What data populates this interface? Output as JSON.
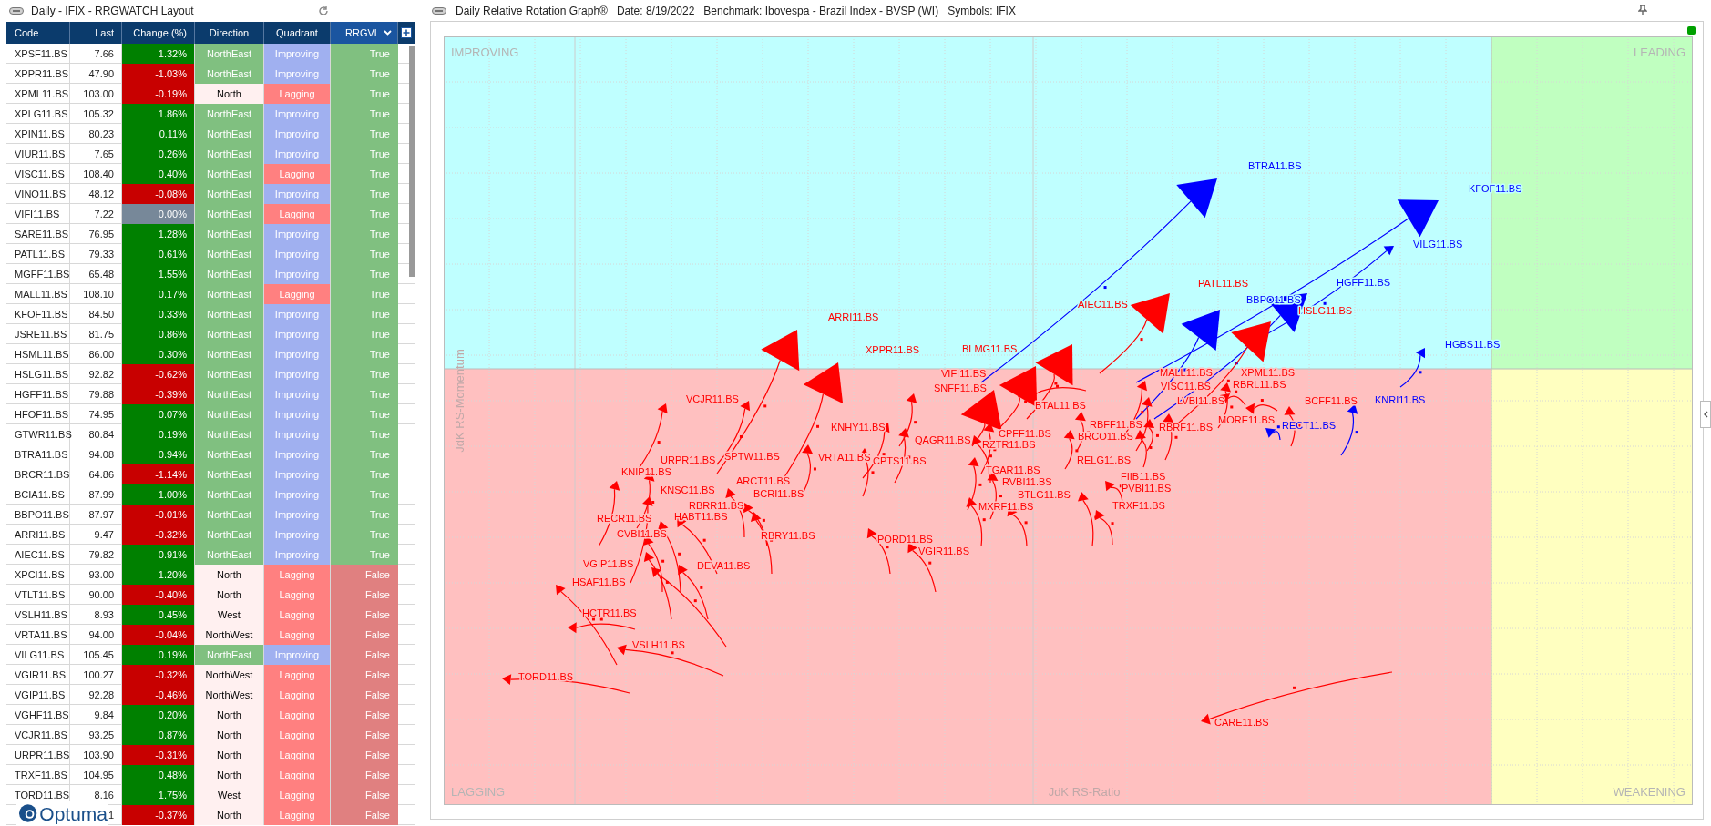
{
  "watchlist": {
    "title": "Daily - IFIX - RRGWATCH Layout",
    "columns": [
      "Code",
      "Last",
      "Change (%)",
      "Direction",
      "Quadrant",
      "RRGVL"
    ],
    "rows": [
      {
        "code": "XPSF11.BS",
        "last": "7.66",
        "change": {
          "text": "1.32%",
          "color": "#008000"
        },
        "direction": {
          "text": "NorthEast",
          "color": "#80c080"
        },
        "quadrant": {
          "text": "Improving",
          "color": "#a0b0f0"
        },
        "rrgvl": {
          "text": "True",
          "color": "#80c080"
        }
      },
      {
        "code": "XPPR11.BS",
        "last": "47.90",
        "change": {
          "text": "-1.03%",
          "color": "#c80000"
        },
        "direction": {
          "text": "NorthEast",
          "color": "#80c080"
        },
        "quadrant": {
          "text": "Improving",
          "color": "#a0b0f0"
        },
        "rrgvl": {
          "text": "True",
          "color": "#80c080"
        }
      },
      {
        "code": "XPML11.BS",
        "last": "103.00",
        "change": {
          "text": "-0.19%",
          "color": "#c80000"
        },
        "direction": {
          "text": "North",
          "color": "#fff0f0"
        },
        "quadrant": {
          "text": "Lagging",
          "color": "#ff8080"
        },
        "rrgvl": {
          "text": "True",
          "color": "#80c080"
        }
      },
      {
        "code": "XPLG11.BS",
        "last": "105.32",
        "change": {
          "text": "1.86%",
          "color": "#008000"
        },
        "direction": {
          "text": "NorthEast",
          "color": "#80c080"
        },
        "quadrant": {
          "text": "Improving",
          "color": "#a0b0f0"
        },
        "rrgvl": {
          "text": "True",
          "color": "#80c080"
        }
      },
      {
        "code": "XPIN11.BS",
        "last": "80.23",
        "change": {
          "text": "0.11%",
          "color": "#008000"
        },
        "direction": {
          "text": "NorthEast",
          "color": "#80c080"
        },
        "quadrant": {
          "text": "Improving",
          "color": "#a0b0f0"
        },
        "rrgvl": {
          "text": "True",
          "color": "#80c080"
        }
      },
      {
        "code": "VIUR11.BS",
        "last": "7.65",
        "change": {
          "text": "0.26%",
          "color": "#008000"
        },
        "direction": {
          "text": "NorthEast",
          "color": "#80c080"
        },
        "quadrant": {
          "text": "Improving",
          "color": "#a0b0f0"
        },
        "rrgvl": {
          "text": "True",
          "color": "#80c080"
        }
      },
      {
        "code": "VISC11.BS",
        "last": "108.40",
        "change": {
          "text": "0.40%",
          "color": "#008000"
        },
        "direction": {
          "text": "NorthEast",
          "color": "#80c080"
        },
        "quadrant": {
          "text": "Lagging",
          "color": "#ff8080"
        },
        "rrgvl": {
          "text": "True",
          "color": "#80c080"
        }
      },
      {
        "code": "VINO11.BS",
        "last": "48.12",
        "change": {
          "text": "-0.08%",
          "color": "#c80000"
        },
        "direction": {
          "text": "NorthEast",
          "color": "#80c080"
        },
        "quadrant": {
          "text": "Improving",
          "color": "#a0b0f0"
        },
        "rrgvl": {
          "text": "True",
          "color": "#80c080"
        }
      },
      {
        "code": "VIFI11.BS",
        "last": "7.22",
        "change": {
          "text": "0.00%",
          "color": "#778899"
        },
        "direction": {
          "text": "NorthEast",
          "color": "#80c080"
        },
        "quadrant": {
          "text": "Lagging",
          "color": "#ff8080"
        },
        "rrgvl": {
          "text": "True",
          "color": "#80c080"
        }
      },
      {
        "code": "SARE11.BS",
        "last": "76.95",
        "change": {
          "text": "1.28%",
          "color": "#008000"
        },
        "direction": {
          "text": "NorthEast",
          "color": "#80c080"
        },
        "quadrant": {
          "text": "Improving",
          "color": "#a0b0f0"
        },
        "rrgvl": {
          "text": "True",
          "color": "#80c080"
        }
      },
      {
        "code": "PATL11.BS",
        "last": "79.33",
        "change": {
          "text": "0.61%",
          "color": "#008000"
        },
        "direction": {
          "text": "NorthEast",
          "color": "#80c080"
        },
        "quadrant": {
          "text": "Improving",
          "color": "#a0b0f0"
        },
        "rrgvl": {
          "text": "True",
          "color": "#80c080"
        }
      },
      {
        "code": "MGFF11.BS",
        "last": "65.48",
        "change": {
          "text": "1.55%",
          "color": "#008000"
        },
        "direction": {
          "text": "NorthEast",
          "color": "#80c080"
        },
        "quadrant": {
          "text": "Improving",
          "color": "#a0b0f0"
        },
        "rrgvl": {
          "text": "True",
          "color": "#80c080"
        }
      },
      {
        "code": "MALL11.BS",
        "last": "108.10",
        "change": {
          "text": "0.17%",
          "color": "#008000"
        },
        "direction": {
          "text": "NorthEast",
          "color": "#80c080"
        },
        "quadrant": {
          "text": "Lagging",
          "color": "#ff8080"
        },
        "rrgvl": {
          "text": "True",
          "color": "#80c080"
        }
      },
      {
        "code": "KFOF11.BS",
        "last": "84.50",
        "change": {
          "text": "0.33%",
          "color": "#008000"
        },
        "direction": {
          "text": "NorthEast",
          "color": "#80c080"
        },
        "quadrant": {
          "text": "Improving",
          "color": "#a0b0f0"
        },
        "rrgvl": {
          "text": "True",
          "color": "#80c080"
        }
      },
      {
        "code": "JSRE11.BS",
        "last": "81.75",
        "change": {
          "text": "0.86%",
          "color": "#008000"
        },
        "direction": {
          "text": "NorthEast",
          "color": "#80c080"
        },
        "quadrant": {
          "text": "Improving",
          "color": "#a0b0f0"
        },
        "rrgvl": {
          "text": "True",
          "color": "#80c080"
        }
      },
      {
        "code": "HSML11.BS",
        "last": "86.00",
        "change": {
          "text": "0.30%",
          "color": "#008000"
        },
        "direction": {
          "text": "NorthEast",
          "color": "#80c080"
        },
        "quadrant": {
          "text": "Improving",
          "color": "#a0b0f0"
        },
        "rrgvl": {
          "text": "True",
          "color": "#80c080"
        }
      },
      {
        "code": "HSLG11.BS",
        "last": "92.82",
        "change": {
          "text": "-0.62%",
          "color": "#c80000"
        },
        "direction": {
          "text": "NorthEast",
          "color": "#80c080"
        },
        "quadrant": {
          "text": "Improving",
          "color": "#a0b0f0"
        },
        "rrgvl": {
          "text": "True",
          "color": "#80c080"
        }
      },
      {
        "code": "HGFF11.BS",
        "last": "79.88",
        "change": {
          "text": "-0.39%",
          "color": "#c80000"
        },
        "direction": {
          "text": "NorthEast",
          "color": "#80c080"
        },
        "quadrant": {
          "text": "Improving",
          "color": "#a0b0f0"
        },
        "rrgvl": {
          "text": "True",
          "color": "#80c080"
        }
      },
      {
        "code": "HFOF11.BS",
        "last": "74.95",
        "change": {
          "text": "0.07%",
          "color": "#008000"
        },
        "direction": {
          "text": "NorthEast",
          "color": "#80c080"
        },
        "quadrant": {
          "text": "Improving",
          "color": "#a0b0f0"
        },
        "rrgvl": {
          "text": "True",
          "color": "#80c080"
        }
      },
      {
        "code": "GTWR11.BS",
        "last": "80.84",
        "change": {
          "text": "0.19%",
          "color": "#008000"
        },
        "direction": {
          "text": "NorthEast",
          "color": "#80c080"
        },
        "quadrant": {
          "text": "Improving",
          "color": "#a0b0f0"
        },
        "rrgvl": {
          "text": "True",
          "color": "#80c080"
        }
      },
      {
        "code": "BTRA11.BS",
        "last": "94.08",
        "change": {
          "text": "0.94%",
          "color": "#008000"
        },
        "direction": {
          "text": "NorthEast",
          "color": "#80c080"
        },
        "quadrant": {
          "text": "Improving",
          "color": "#a0b0f0"
        },
        "rrgvl": {
          "text": "True",
          "color": "#80c080"
        }
      },
      {
        "code": "BRCR11.BS",
        "last": "64.86",
        "change": {
          "text": "-1.14%",
          "color": "#c80000"
        },
        "direction": {
          "text": "NorthEast",
          "color": "#80c080"
        },
        "quadrant": {
          "text": "Improving",
          "color": "#a0b0f0"
        },
        "rrgvl": {
          "text": "True",
          "color": "#80c080"
        }
      },
      {
        "code": "BCIA11.BS",
        "last": "87.99",
        "change": {
          "text": "1.00%",
          "color": "#008000"
        },
        "direction": {
          "text": "NorthEast",
          "color": "#80c080"
        },
        "quadrant": {
          "text": "Improving",
          "color": "#a0b0f0"
        },
        "rrgvl": {
          "text": "True",
          "color": "#80c080"
        }
      },
      {
        "code": "BBPO11.BS",
        "last": "87.97",
        "change": {
          "text": "-0.01%",
          "color": "#c80000"
        },
        "direction": {
          "text": "NorthEast",
          "color": "#80c080"
        },
        "quadrant": {
          "text": "Improving",
          "color": "#a0b0f0"
        },
        "rrgvl": {
          "text": "True",
          "color": "#80c080"
        }
      },
      {
        "code": "ARRI11.BS",
        "last": "9.47",
        "change": {
          "text": "-0.32%",
          "color": "#c80000"
        },
        "direction": {
          "text": "NorthEast",
          "color": "#80c080"
        },
        "quadrant": {
          "text": "Improving",
          "color": "#a0b0f0"
        },
        "rrgvl": {
          "text": "True",
          "color": "#80c080"
        }
      },
      {
        "code": "AIEC11.BS",
        "last": "79.82",
        "change": {
          "text": "0.91%",
          "color": "#008000"
        },
        "direction": {
          "text": "NorthEast",
          "color": "#80c080"
        },
        "quadrant": {
          "text": "Improving",
          "color": "#a0b0f0"
        },
        "rrgvl": {
          "text": "True",
          "color": "#80c080"
        }
      },
      {
        "code": "XPCI11.BS",
        "last": "93.00",
        "change": {
          "text": "1.20%",
          "color": "#008000"
        },
        "direction": {
          "text": "North",
          "color": "#fff0f0"
        },
        "quadrant": {
          "text": "Lagging",
          "color": "#ff8080"
        },
        "rrgvl": {
          "text": "False",
          "color": "#e08080"
        }
      },
      {
        "code": "VTLT11.BS",
        "last": "90.00",
        "change": {
          "text": "-0.40%",
          "color": "#c80000"
        },
        "direction": {
          "text": "North",
          "color": "#fff0f0"
        },
        "quadrant": {
          "text": "Lagging",
          "color": "#ff8080"
        },
        "rrgvl": {
          "text": "False",
          "color": "#e08080"
        }
      },
      {
        "code": "VSLH11.BS",
        "last": "8.93",
        "change": {
          "text": "0.45%",
          "color": "#008000"
        },
        "direction": {
          "text": "West",
          "color": "#fff0f0"
        },
        "quadrant": {
          "text": "Lagging",
          "color": "#ff8080"
        },
        "rrgvl": {
          "text": "False",
          "color": "#e08080"
        }
      },
      {
        "code": "VRTA11.BS",
        "last": "94.00",
        "change": {
          "text": "-0.04%",
          "color": "#c80000"
        },
        "direction": {
          "text": "NorthWest",
          "color": "#fff0f0"
        },
        "quadrant": {
          "text": "Lagging",
          "color": "#ff8080"
        },
        "rrgvl": {
          "text": "False",
          "color": "#e08080"
        }
      },
      {
        "code": "VILG11.BS",
        "last": "105.45",
        "change": {
          "text": "0.19%",
          "color": "#008000"
        },
        "direction": {
          "text": "NorthEast",
          "color": "#80c080"
        },
        "quadrant": {
          "text": "Improving",
          "color": "#a0b0f0"
        },
        "rrgvl": {
          "text": "False",
          "color": "#e08080"
        }
      },
      {
        "code": "VGIR11.BS",
        "last": "100.27",
        "change": {
          "text": "-0.32%",
          "color": "#c80000"
        },
        "direction": {
          "text": "NorthWest",
          "color": "#fff0f0"
        },
        "quadrant": {
          "text": "Lagging",
          "color": "#ff8080"
        },
        "rrgvl": {
          "text": "False",
          "color": "#e08080"
        }
      },
      {
        "code": "VGIP11.BS",
        "last": "92.28",
        "change": {
          "text": "-0.46%",
          "color": "#c80000"
        },
        "direction": {
          "text": "NorthWest",
          "color": "#fff0f0"
        },
        "quadrant": {
          "text": "Lagging",
          "color": "#ff8080"
        },
        "rrgvl": {
          "text": "False",
          "color": "#e08080"
        }
      },
      {
        "code": "VGHF11.BS",
        "last": "9.84",
        "change": {
          "text": "0.20%",
          "color": "#008000"
        },
        "direction": {
          "text": "North",
          "color": "#fff0f0"
        },
        "quadrant": {
          "text": "Lagging",
          "color": "#ff8080"
        },
        "rrgvl": {
          "text": "False",
          "color": "#e08080"
        }
      },
      {
        "code": "VCJR11.BS",
        "last": "93.25",
        "change": {
          "text": "0.87%",
          "color": "#008000"
        },
        "direction": {
          "text": "North",
          "color": "#fff0f0"
        },
        "quadrant": {
          "text": "Lagging",
          "color": "#ff8080"
        },
        "rrgvl": {
          "text": "False",
          "color": "#e08080"
        }
      },
      {
        "code": "URPR11.BS",
        "last": "103.90",
        "change": {
          "text": "-0.31%",
          "color": "#c80000"
        },
        "direction": {
          "text": "North",
          "color": "#fff0f0"
        },
        "quadrant": {
          "text": "Lagging",
          "color": "#ff8080"
        },
        "rrgvl": {
          "text": "False",
          "color": "#e08080"
        }
      },
      {
        "code": "TRXF11.BS",
        "last": "104.95",
        "change": {
          "text": "0.48%",
          "color": "#008000"
        },
        "direction": {
          "text": "North",
          "color": "#fff0f0"
        },
        "quadrant": {
          "text": "Lagging",
          "color": "#ff8080"
        },
        "rrgvl": {
          "text": "False",
          "color": "#e08080"
        }
      },
      {
        "code": "TORD11.BS",
        "last": "8.16",
        "change": {
          "text": "1.75%",
          "color": "#008000"
        },
        "direction": {
          "text": "West",
          "color": "#fff0f0"
        },
        "quadrant": {
          "text": "Lagging",
          "color": "#ff8080"
        },
        "rrgvl": {
          "text": "False",
          "color": "#e08080"
        }
      },
      {
        "last": "1",
        "change": {
          "text": "-0.37%",
          "color": "#c80000"
        },
        "direction": {
          "text": "North",
          "color": "#fff0f0"
        },
        "quadrant": {
          "text": "Lagging",
          "color": "#ff8080"
        },
        "rrgvl": {
          "text": "False",
          "color": "#e08080"
        }
      }
    ],
    "logo": "Optuma"
  },
  "rrg": {
    "title": "Daily Relative Rotation Graph®",
    "date": "Date: 8/19/2022",
    "benchmark": "Benchmark: Ibovespa - Brazil Index - BVSP (WI)",
    "symbols": "Symbols: IFIX",
    "quadrants": [
      {
        "label": "IMPROVING",
        "color": "#bfffff"
      },
      {
        "label": "LEADING",
        "color": "#c0ffc0"
      },
      {
        "label": "LAGGING",
        "color": "#ffc0c0"
      },
      {
        "label": "WEAKENING",
        "color": "#ffffc0"
      }
    ],
    "x_axis_label": "JdK RS-Ratio",
    "y_axis_label": "JdK RS-Momentum",
    "series": [
      {
        "label": "ARRI11.BS",
        "color": "#ff0000"
      },
      {
        "label": "XPPR11.BS",
        "color": "#ff0000"
      },
      {
        "label": "BLMG11.BS",
        "color": "#ff0000"
      },
      {
        "label": "VIFI11.BS",
        "color": "#ff0000"
      },
      {
        "label": "VCJR11.BS",
        "color": "#ff0000"
      },
      {
        "label": "SNFF11.BS",
        "color": "#ff0000"
      },
      {
        "label": "BTAL11.BS",
        "color": "#ff0000"
      },
      {
        "label": "BTRA11.BS",
        "color": "#0000ff"
      },
      {
        "label": "KFOF11.BS",
        "color": "#0000ff"
      },
      {
        "label": "VILG11.BS",
        "color": "#0000ff"
      },
      {
        "label": "HGFF11.BS",
        "color": "#0000ff"
      },
      {
        "label": "PATL11.BS",
        "color": "#ff0000"
      },
      {
        "label": "AIEC11.BS",
        "color": "#ff0000"
      },
      {
        "label": "BBPO11.BS",
        "color": "#0000ff"
      },
      {
        "label": "HSLG11.BS",
        "color": "#ff0000"
      },
      {
        "label": "HGBS11.BS",
        "color": "#0000ff"
      },
      {
        "label": "MALL11.BS",
        "color": "#ff0000"
      },
      {
        "label": "XPML11.BS",
        "color": "#ff0000"
      },
      {
        "label": "VISC11.BS",
        "color": "#ff0000"
      },
      {
        "label": "RBRL11.BS",
        "color": "#ff0000"
      },
      {
        "label": "LVBI11.BS",
        "color": "#ff0000"
      },
      {
        "label": "BCFF11.BS",
        "color": "#ff0000"
      },
      {
        "label": "KNRI11.BS",
        "color": "#0000ff"
      },
      {
        "label": "RBFF11.BS",
        "color": "#ff0000"
      },
      {
        "label": "RBRF11.BS",
        "color": "#ff0000"
      },
      {
        "label": "MORE11.BS",
        "color": "#ff0000"
      },
      {
        "label": "RECT11.BS",
        "color": "#0000ff"
      },
      {
        "label": "BRCO11.BS",
        "color": "#ff0000"
      },
      {
        "label": "RELG11.BS",
        "color": "#ff0000"
      },
      {
        "label": "FIIB11.BS",
        "color": "#ff0000"
      },
      {
        "label": "PVBI11.BS",
        "color": "#ff0000"
      },
      {
        "label": "TRXF11.BS",
        "color": "#ff0000"
      },
      {
        "label": "CARE11.BS",
        "color": "#ff0000"
      },
      {
        "label": "KNHY11.BS",
        "color": "#ff0000"
      },
      {
        "label": "QAGR11.BS",
        "color": "#ff0000"
      },
      {
        "label": "CPFF11.BS",
        "color": "#ff0000"
      },
      {
        "label": "RZTR11.BS",
        "color": "#ff0000"
      },
      {
        "label": "VRTA11.BS",
        "color": "#ff0000"
      },
      {
        "label": "CPTS11.BS",
        "color": "#ff0000"
      },
      {
        "label": "TGAR11.BS",
        "color": "#ff0000"
      },
      {
        "label": "URPR11.BS",
        "color": "#ff0000"
      },
      {
        "label": "SPTW11.BS",
        "color": "#ff0000"
      },
      {
        "label": "KNIP11.BS",
        "color": "#ff0000"
      },
      {
        "label": "KNSC11.BS",
        "color": "#ff0000"
      },
      {
        "label": "ARCT11.BS",
        "color": "#ff0000"
      },
      {
        "label": "BCRI11.BS",
        "color": "#ff0000"
      },
      {
        "label": "RBRR11.BS",
        "color": "#ff0000"
      },
      {
        "label": "HABT11.BS",
        "color": "#ff0000"
      },
      {
        "label": "RECR11.BS",
        "color": "#ff0000"
      },
      {
        "label": "CVBI11.BS",
        "color": "#ff0000"
      },
      {
        "label": "RBRY11.BS",
        "color": "#ff0000"
      },
      {
        "label": "DEVA11.BS",
        "color": "#ff0000"
      },
      {
        "label": "VGIP11.BS",
        "color": "#ff0000"
      },
      {
        "label": "HSAF11.BS",
        "color": "#ff0000"
      },
      {
        "label": "HCTR11.BS",
        "color": "#ff0000"
      },
      {
        "label": "VSLH11.BS",
        "color": "#ff0000"
      },
      {
        "label": "TORD11.BS",
        "color": "#ff0000"
      },
      {
        "label": "RVBI11.BS",
        "color": "#ff0000"
      },
      {
        "label": "BTLG11.BS",
        "color": "#ff0000"
      },
      {
        "label": "MXRF11.BS",
        "color": "#ff0000"
      },
      {
        "label": "PORD11.BS",
        "color": "#ff0000"
      },
      {
        "label": "VGIR11.BS",
        "color": "#ff0000"
      }
    ]
  }
}
